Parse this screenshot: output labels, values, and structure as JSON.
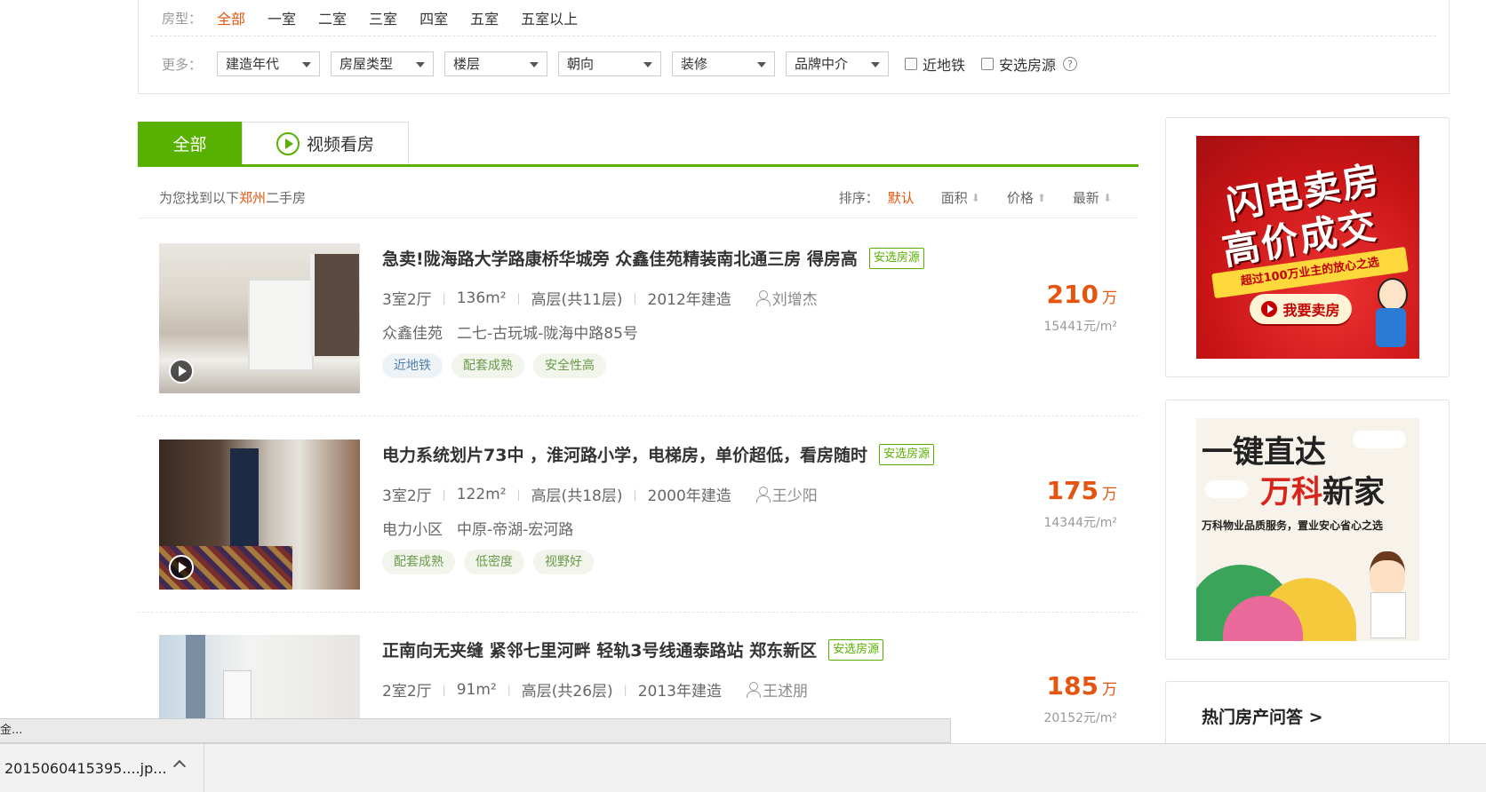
{
  "filters": {
    "type_label": "房型：",
    "type_options": [
      "全部",
      "一室",
      "二室",
      "三室",
      "四室",
      "五室",
      "五室以上"
    ],
    "active_type": "全部",
    "more_label": "更多：",
    "selects": [
      "建造年代",
      "房屋类型",
      "楼层",
      "朝向",
      "装修",
      "品牌中介"
    ],
    "near_subway": "近地铁",
    "safe_source": "安选房源",
    "help": "?"
  },
  "tabs": {
    "all": "全部",
    "video": "视频看房"
  },
  "result": {
    "prefix": "为您找到以下",
    "city": "郑州",
    "suffix": "二手房",
    "sort_label": "排序：",
    "sort_options": [
      "默认",
      "面积",
      "价格",
      "最新"
    ],
    "sort_arrows": [
      "⬇",
      "⬆",
      "⬇"
    ]
  },
  "listings": [
    {
      "title": "急卖!陇海路大学路康桥华城旁 众鑫佳苑精装南北通三房 得房高",
      "badge": "安选房源",
      "layout": "3室2厅",
      "area": "136m²",
      "floor": "高层(共11层)",
      "year": "2012年建造",
      "agent": "刘增杰",
      "community": "众鑫佳苑",
      "address": "二七-古玩城-陇海中路85号",
      "tags": [
        "近地铁",
        "配套成熟",
        "安全性高"
      ],
      "price": "210",
      "price_unit": "万",
      "unit_price": "15441元/m²"
    },
    {
      "title": "电力系统划片73中 ，淮河路小学，电梯房，单价超低，看房随时",
      "badge": "安选房源",
      "layout": "3室2厅",
      "area": "122m²",
      "floor": "高层(共18层)",
      "year": "2000年建造",
      "agent": "王少阳",
      "community": "电力小区",
      "address": "中原-帝湖-宏河路",
      "tags": [
        "配套成熟",
        "低密度",
        "视野好"
      ],
      "price": "175",
      "price_unit": "万",
      "unit_price": "14344元/m²"
    },
    {
      "title": "正南向无夹缝 紧邻七里河畔 轻轨3号线通泰路站 郑东新区",
      "badge": "安选房源",
      "layout": "2室2厅",
      "area": "91m²",
      "floor": "高层(共26层)",
      "year": "2013年建造",
      "agent": "王述朋",
      "price": "185",
      "price_unit": "万",
      "unit_price": "20152元/m²"
    }
  ],
  "ads": {
    "ad1_line1": "闪电卖房",
    "ad1_line2": "高价成交",
    "ad1_banner": "超过100万业主的放心之选",
    "ad1_button": "我要卖房",
    "ad2_line1": "一键直达",
    "ad2_line2_red": "万科",
    "ad2_line2_black": "新家",
    "ad2_sub": "万科物业品质服务，置业安心省心之选",
    "hot_qa": "热门房产问答 >"
  },
  "browser": {
    "status_text": "金...",
    "download_file": "2015060415395....jp..."
  },
  "colors": {
    "accent_green": "#58b000",
    "accent_orange": "#e4560f"
  }
}
